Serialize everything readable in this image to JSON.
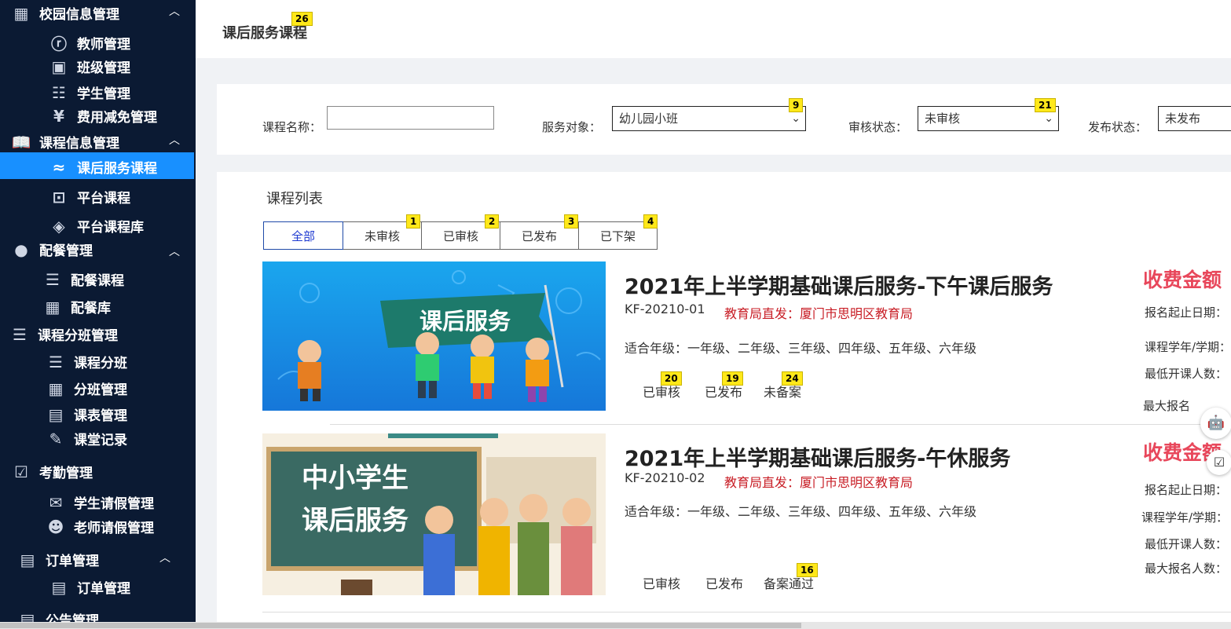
{
  "sidebar": {
    "groups": [
      {
        "label": "校园信息管理",
        "icon": "school-icon"
      },
      {
        "label": "课程信息管理",
        "icon": "book-icon"
      },
      {
        "label": "配餐管理",
        "icon": "dining-icon"
      },
      {
        "label": "课程分班管理",
        "icon": "class-split-icon"
      },
      {
        "label": "考勤管理",
        "icon": "calendar-check-icon"
      },
      {
        "label": "订单管理",
        "icon": "order-icon"
      },
      {
        "label": "公告管理",
        "icon": "notice-icon"
      }
    ],
    "items": [
      {
        "label": "教师管理",
        "icon": "teacher-icon"
      },
      {
        "label": "班级管理",
        "icon": "classroom-icon"
      },
      {
        "label": "学生管理",
        "icon": "student-icon"
      },
      {
        "label": "费用减免管理",
        "icon": "yuan-icon"
      },
      {
        "label": "课后服务课程",
        "icon": "after-school-icon"
      },
      {
        "label": "平台课程",
        "icon": "platform-course-icon"
      },
      {
        "label": "平台课程库",
        "icon": "layers-icon"
      },
      {
        "label": "配餐课程",
        "icon": "meal-course-icon"
      },
      {
        "label": "配餐库",
        "icon": "grid-icon"
      },
      {
        "label": "课程分班",
        "icon": "split-icon"
      },
      {
        "label": "分班管理",
        "icon": "grid-icon"
      },
      {
        "label": "课表管理",
        "icon": "timetable-icon"
      },
      {
        "label": "课堂记录",
        "icon": "record-icon"
      },
      {
        "label": "学生请假管理",
        "icon": "leave-icon"
      },
      {
        "label": "老师请假管理",
        "icon": "teacher-leave-icon"
      },
      {
        "label": "订单管理",
        "icon": "order-icon"
      }
    ]
  },
  "header": {
    "title": "课后服务课程"
  },
  "filters": {
    "course_name_label": "课程名称：",
    "course_name_value": "",
    "service_target_label": "服务对象：",
    "service_target_value": "幼儿园小班",
    "review_status_label": "审核状态：",
    "review_status_value": "未审核",
    "publish_status_label": "发布状态：",
    "publish_status_value": "未发布"
  },
  "list": {
    "title": "课程列表",
    "tabs": [
      "全部",
      "未审核",
      "已审核",
      "已发布",
      "已下架"
    ],
    "courses": [
      {
        "title": "2021年上半学期基础课后服务-下午课后服务",
        "code": "KF-20210-01",
        "issuer": "教育局直发：厦门市思明区教育局",
        "grades": "适合年级：一年级、二年级、三年级、四年级、五年级、六年级",
        "statuses": [
          "已审核",
          "已发布",
          "未备案"
        ],
        "fee": "收费金额",
        "meta": [
          "报名起止日期：",
          "课程学年/学期：",
          "最低开课人数：",
          "最大报名"
        ],
        "image_text": "课后服务"
      },
      {
        "title": "2021年上半学期基础课后服务-午休服务",
        "code": "KF-20210-02",
        "issuer": "教育局直发：厦门市思明区教育局",
        "grades": "适合年级：一年级、二年级、三年级、四年级、五年级、六年级",
        "statuses": [
          "已审核",
          "已发布",
          "备案通过"
        ],
        "fee": "收费金额",
        "meta": [
          "报名起止日期：",
          "课程学年/学期：",
          "最低开课人数：",
          "最大报名人数："
        ],
        "image_text_1": "中小学生",
        "image_text_2": "课后服务"
      }
    ]
  },
  "badges": {
    "b1": "1",
    "b2": "2",
    "b3": "3",
    "b4": "4",
    "b9": "9",
    "b16": "16",
    "b19": "19",
    "b20": "20",
    "b21": "21",
    "b24": "24",
    "b26": "26"
  },
  "colors": {
    "sidebar_bg": "#0b1a33",
    "active": "#1890ff",
    "fee": "#e8475b",
    "issuer": "#c81d25"
  }
}
